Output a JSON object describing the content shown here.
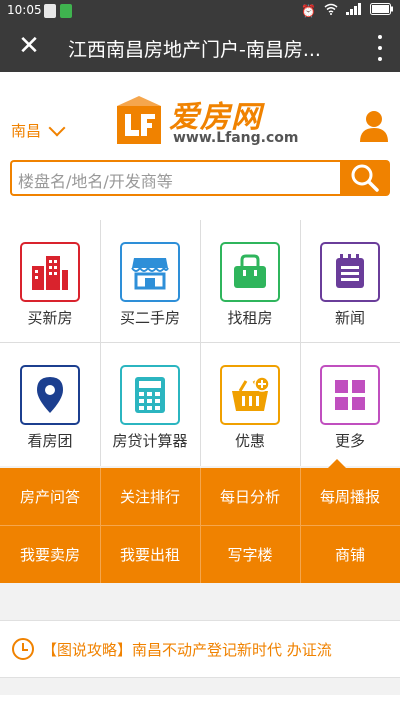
{
  "status_bar": {
    "time": "10:05",
    "icons": [
      "sim-icon",
      "alarm-icon",
      "wifi-icon",
      "signal-icon",
      "battery-icon"
    ]
  },
  "title_bar": {
    "title": "江西南昌房地产门户-南昌房..."
  },
  "header": {
    "city": "南昌",
    "logo_text": "爱房网",
    "logo_url": "www.Lfang.com",
    "search_placeholder": "楼盘名/地名/开发商等"
  },
  "grid": [
    {
      "label": "买新房",
      "icon": "building-icon",
      "color": "#d9232d"
    },
    {
      "label": "买二手房",
      "icon": "shop-icon",
      "color": "#2e8fd8"
    },
    {
      "label": "找租房",
      "icon": "bag-icon",
      "color": "#2fb55c"
    },
    {
      "label": "新闻",
      "icon": "news-icon",
      "color": "#6a3d9a"
    },
    {
      "label": "看房团",
      "icon": "location-pin-icon",
      "color": "#1c3f8f"
    },
    {
      "label": "房贷计算器",
      "icon": "calculator-icon",
      "color": "#2bb5c0"
    },
    {
      "label": "优惠",
      "icon": "basket-icon",
      "color": "#f0a000"
    },
    {
      "label": "更多",
      "icon": "more-grid-icon",
      "color": "#c04fbf"
    }
  ],
  "orange_menu": [
    "房产问答",
    "关注排行",
    "每日分析",
    "每周播报",
    "我要卖房",
    "我要出租",
    "写字楼",
    "商铺"
  ],
  "news": {
    "text": "【图说攻略】南昌不动产登记新时代 办证流"
  },
  "colors": {
    "accent": "#f08200",
    "dark_bar": "#3a3a3a"
  }
}
